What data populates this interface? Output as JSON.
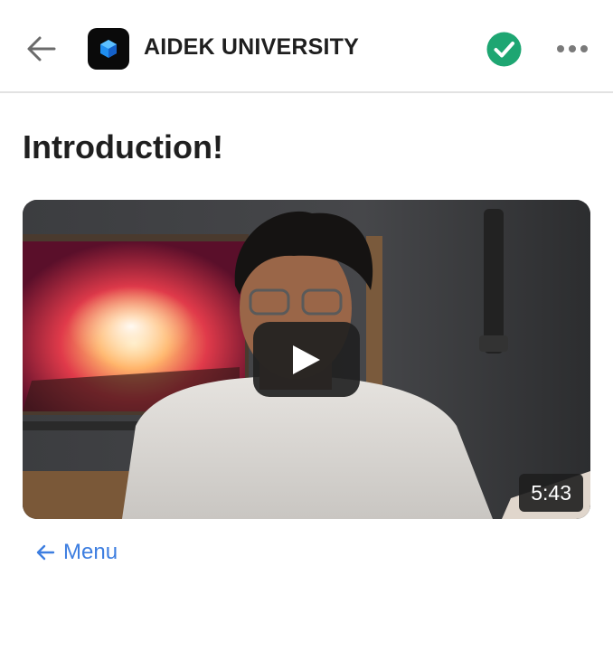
{
  "header": {
    "title": "AIDEK UNIVERSITY",
    "back_icon": "arrow-left-icon",
    "logo_icon": "cube-logo-icon",
    "status_icon": "check-circle-icon",
    "more_icon": "more-horizontal-icon"
  },
  "page": {
    "title": "Introduction!"
  },
  "video": {
    "duration": "5:43",
    "play_icon": "play-icon"
  },
  "nav": {
    "menu_label": "Menu",
    "menu_icon": "arrow-left-icon"
  },
  "colors": {
    "link": "#3d7ee0",
    "check": "#1ea672",
    "divider": "#e2e2e2"
  }
}
